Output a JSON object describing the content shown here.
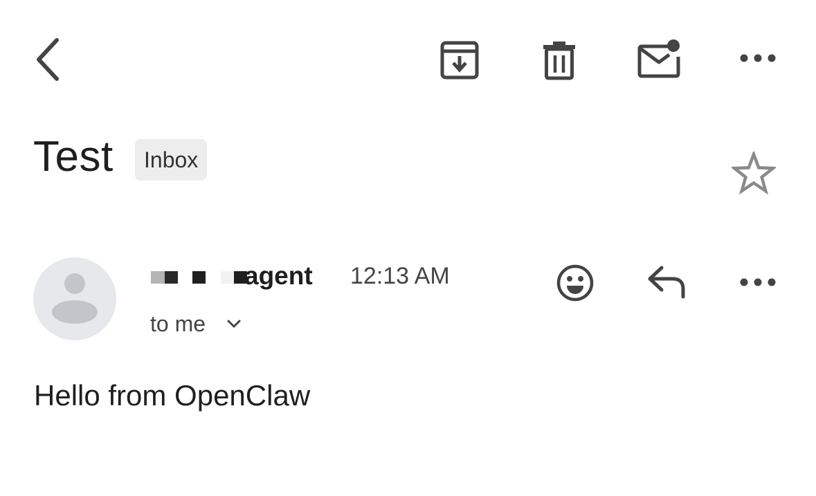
{
  "toolbar": {
    "back_icon": "chevron-left-icon",
    "archive_icon": "archive-icon",
    "delete_icon": "trash-icon",
    "mark_unread_icon": "mail-unread-icon",
    "more_icon": "more-horizontal-icon"
  },
  "message_header": {
    "subject": "Test",
    "label": "Inbox",
    "starred": false,
    "star_icon": "star-outline-icon"
  },
  "sender": {
    "name_visible": "agent",
    "name_redacted": true,
    "time": "12:13 AM",
    "recipients_label": "to me",
    "avatar_icon": "person-avatar-icon",
    "expand_icon": "chevron-down-icon"
  },
  "message_actions": {
    "emoji_icon": "emoji-reaction-icon",
    "reply_icon": "reply-icon",
    "more_icon": "more-horizontal-icon"
  },
  "body": {
    "text": "Hello from OpenClaw"
  },
  "colors": {
    "icon": "#444444",
    "text": "#1f1f1f",
    "chip_bg": "#ededed",
    "avatar_bg": "#e7e8ec",
    "avatar_figure": "#c3c5ca",
    "star_outline": "#8a8a8a"
  }
}
